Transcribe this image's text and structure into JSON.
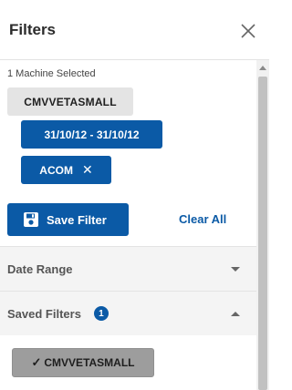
{
  "header": {
    "title": "Filters",
    "close_icon": "close-icon"
  },
  "selection": {
    "machine_count_label": "1 Machine Selected",
    "machine_chip": "CMVVETASMALL",
    "date_chip": "31/10/12 - 31/10/12",
    "acom_chip": "ACOM",
    "acom_remove_symbol": "✕"
  },
  "actions": {
    "save_filter_label": "Save Filter",
    "clear_all_label": "Clear All"
  },
  "sections": {
    "date_range": {
      "label": "Date Range",
      "expanded": false
    },
    "saved_filters": {
      "label": "Saved Filters",
      "count": "1",
      "expanded": true
    }
  },
  "saved_filters": [
    {
      "label": "CMVVETASMALL",
      "checkmark": "✓"
    }
  ],
  "colors": {
    "accent": "#0b5aa6",
    "chip_grey": "#e4e4e4",
    "saved_chip": "#9d9d9d",
    "section_bg": "#f4f4f4"
  }
}
